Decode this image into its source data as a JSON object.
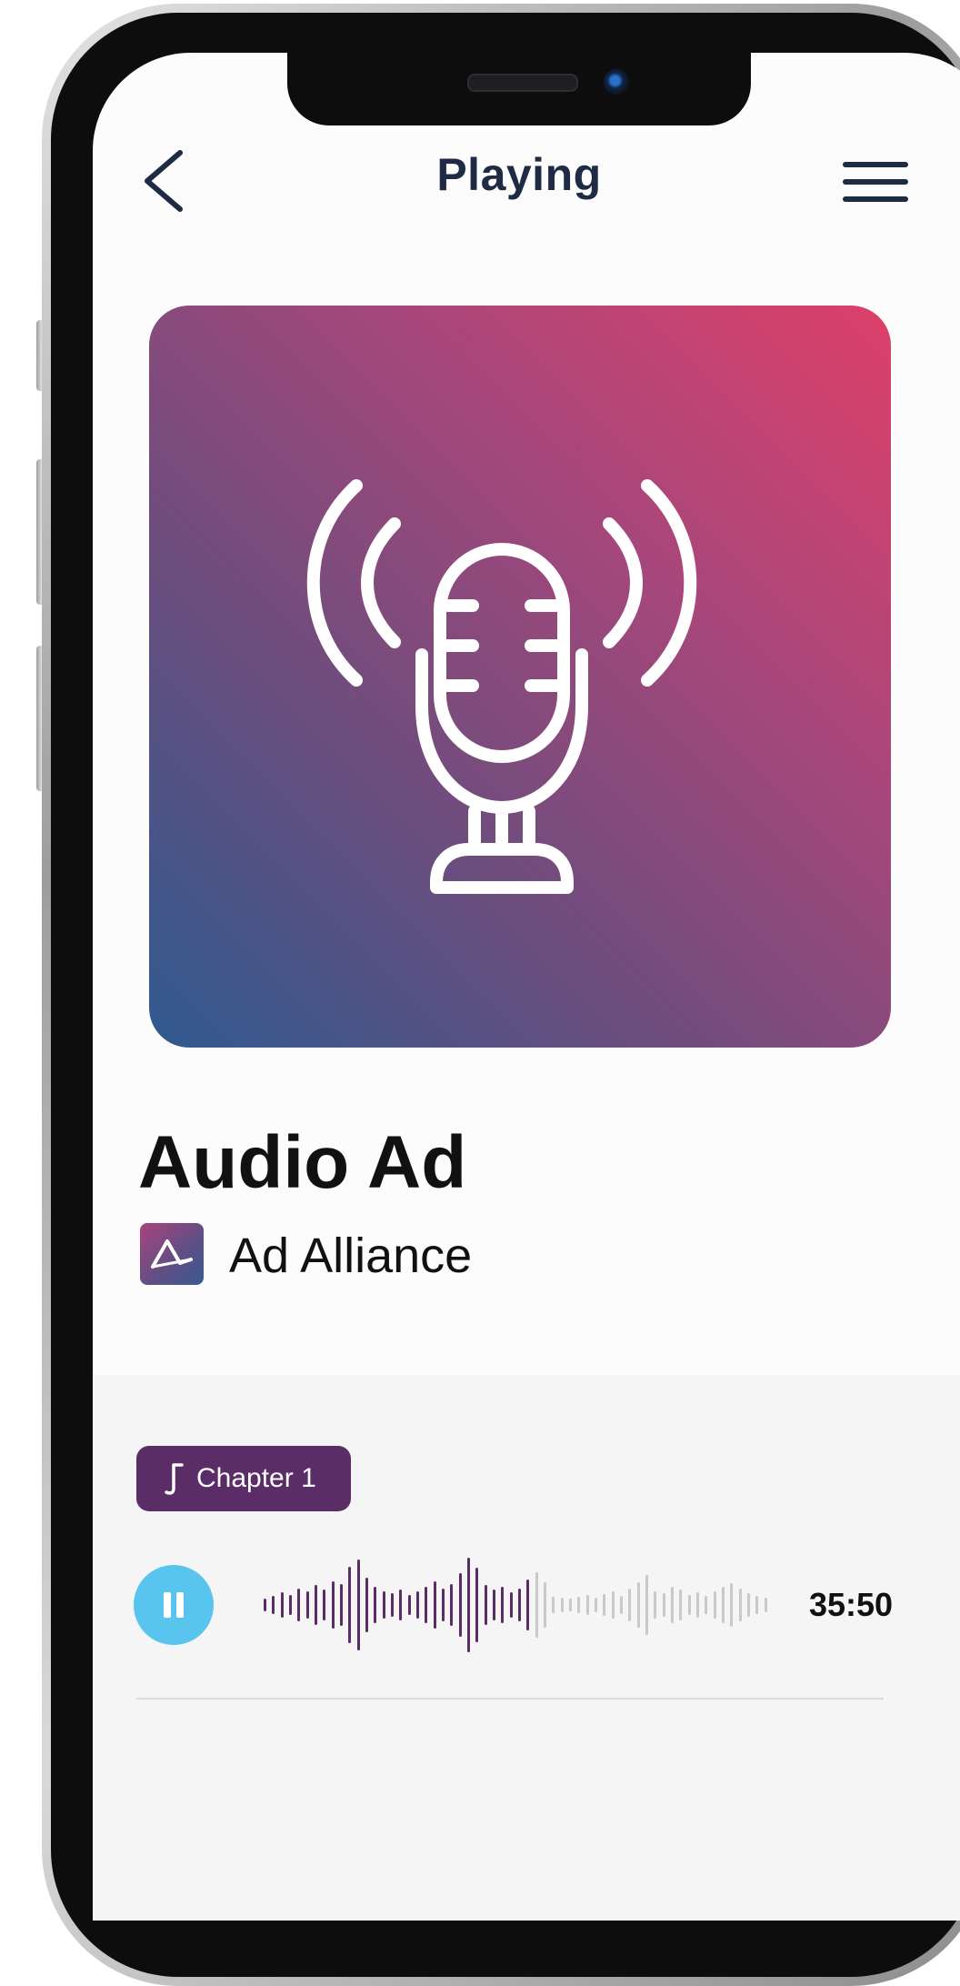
{
  "header": {
    "title": "Playing",
    "back_icon": "chevron-left-icon",
    "menu_icon": "hamburger-menu-icon"
  },
  "artwork": {
    "icon": "podcast-microphone-icon",
    "gradient_colors": [
      "#dd4069",
      "#6d4d7d",
      "#2f5a8f"
    ]
  },
  "track": {
    "title": "Audio Ad",
    "artist": "Ad Alliance",
    "artist_logo": "ad-alliance-logo"
  },
  "player": {
    "chapter_label": "Chapter 1",
    "chapter_icon": "music-note-icon",
    "play_state": "playing",
    "pause_icon": "pause-icon",
    "duration": "35:50",
    "progress": 0.54,
    "colors": {
      "chip": "#5b2d67",
      "button": "#59c4ed",
      "wave_played": "#5b2d67",
      "wave_remaining": "#c9c9cc"
    }
  }
}
